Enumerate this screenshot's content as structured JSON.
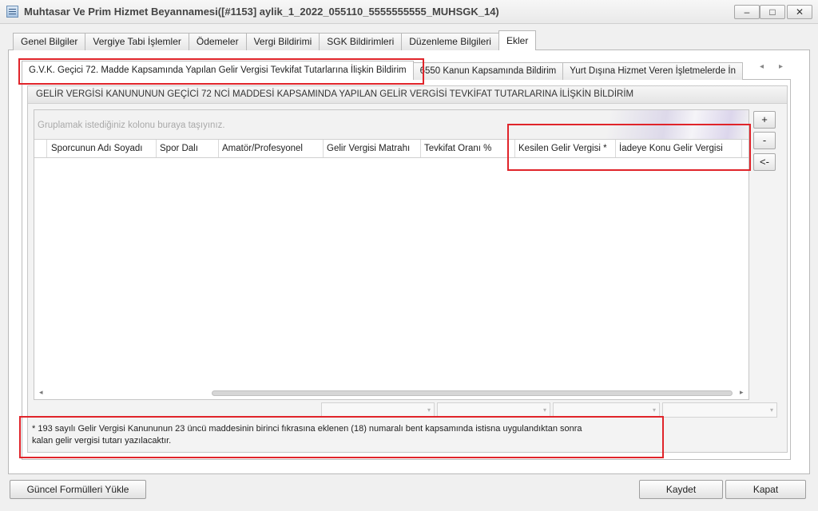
{
  "window": {
    "title": "Muhtasar Ve Prim Hizmet Beyannamesi([#1153] aylik_1_2022_055110_5555555555_MUHSGK_14)",
    "minimize_label": "–",
    "maximize_label": "□",
    "close_label": "✕",
    "icon": "form-document-icon"
  },
  "main_tabs": [
    {
      "label": "Genel Bilgiler"
    },
    {
      "label": "Vergiye Tabi İşlemler"
    },
    {
      "label": "Ödemeler"
    },
    {
      "label": "Vergi Bildirimi"
    },
    {
      "label": "SGK Bildirimleri"
    },
    {
      "label": "Düzenleme Bilgileri"
    },
    {
      "label": "Ekler",
      "active": true
    }
  ],
  "sub_tabs": [
    {
      "label": "G.V.K. Geçici 72. Madde Kapsamında Yapılan Gelir Vergisi Tevkifat Tutarlarına İlişkin Bildirim",
      "active": true
    },
    {
      "label": "6550 Kanun Kapsamında Bildirim"
    },
    {
      "label": "Yurt Dışına Hizmet Veren İşletmelerde İn"
    }
  ],
  "sub_tab_nav": {
    "left": "◂",
    "right": "▸"
  },
  "group": {
    "caption": "GELİR VERGİSİ KANUNUNUN GEÇİCİ 72 NCİ MADDESİ KAPSAMINDA YAPILAN GELİR VERGİSİ TEVKİFAT TUTARLARINA İLİŞKİN BİLDİRİM"
  },
  "grid": {
    "group_hint": "Gruplamak istediğiniz kolonu buraya taşıyınız.",
    "columns": [
      "Sporcunun Adı Soyadı",
      "Spor Dalı",
      "Amatör/Profesyonel",
      "Gelir Vergisi Matrahı",
      "Tevkifat Oranı %",
      "Kesilen Gelir Vergisi *",
      "İadeye Konu Gelir Vergisi"
    ],
    "scroll_left": "◂",
    "scroll_right": "▸"
  },
  "side_buttons": {
    "add": "+",
    "remove": "-",
    "back": "<-"
  },
  "footnote": {
    "line1": "* 193 sayılı Gelir Vergisi Kanununun 23 üncü maddesinin birinci fıkrasına eklenen (18) numaralı bent kapsamında istisna uygulandıktan sonra",
    "line2": "kalan gelir vergisi tutarı yazılacaktır."
  },
  "filter_dropdown_icon": "▾",
  "buttons": {
    "update_formulas": "Güncel Formülleri Yükle",
    "save": "Kaydet",
    "close": "Kapat"
  },
  "colors": {
    "highlight": "#e0242a",
    "window_bg": "#f0f0f0",
    "border": "#b8b8b8"
  }
}
